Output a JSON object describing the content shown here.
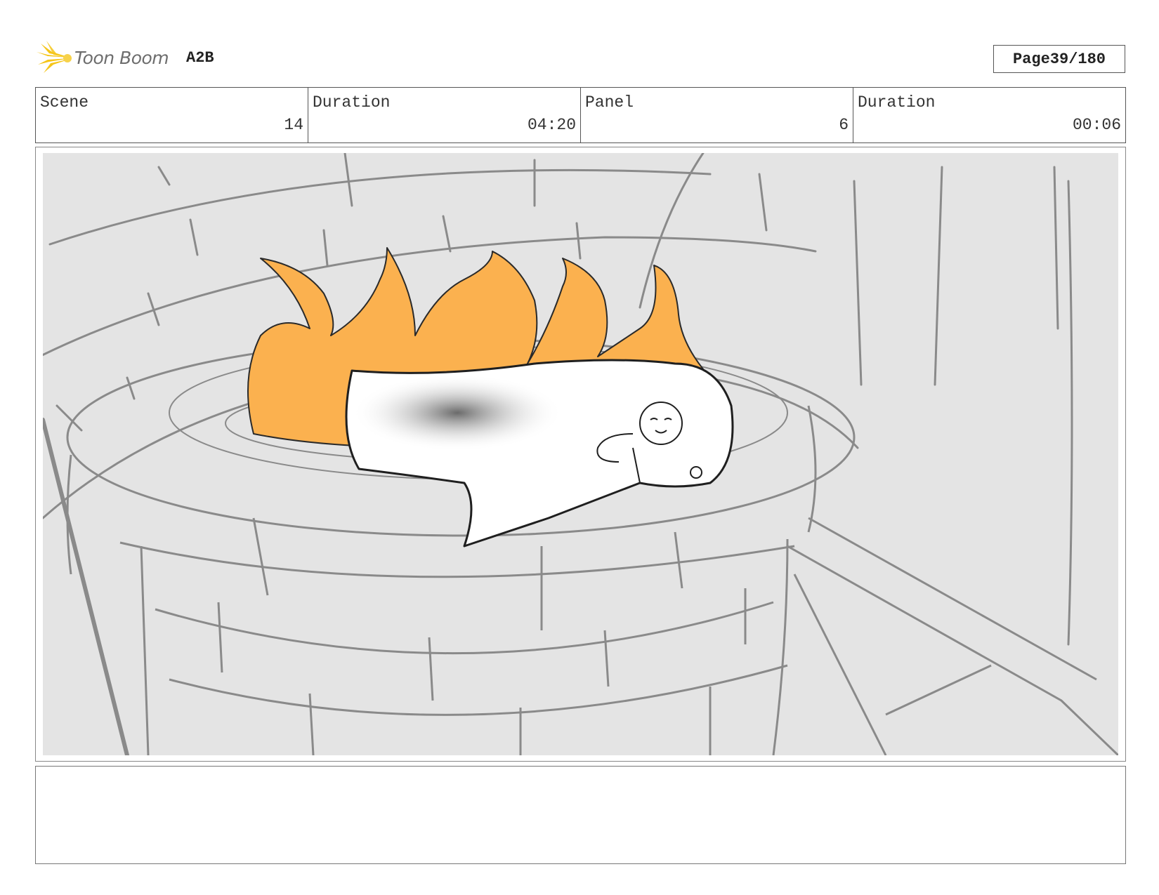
{
  "header": {
    "logo_text": "Toon Boom",
    "project": "A2B",
    "page_label": "Page",
    "page_value": "39/180"
  },
  "info": {
    "scene_label": "Scene",
    "scene_value": "14",
    "scene_duration_label": "Duration",
    "scene_duration_value": "04:20",
    "panel_label": "Panel",
    "panel_value": "6",
    "panel_duration_label": "Duration",
    "panel_duration_value": "00:06"
  },
  "notes": {
    "text": ""
  },
  "colors": {
    "logo_yellow": "#f5c518",
    "flame_orange": "#fbb14f",
    "sketch_gray": "#8a8a8a",
    "panel_bg": "#e4e4e4"
  },
  "icons": {
    "logo": "toon-boom-burst-icon"
  }
}
